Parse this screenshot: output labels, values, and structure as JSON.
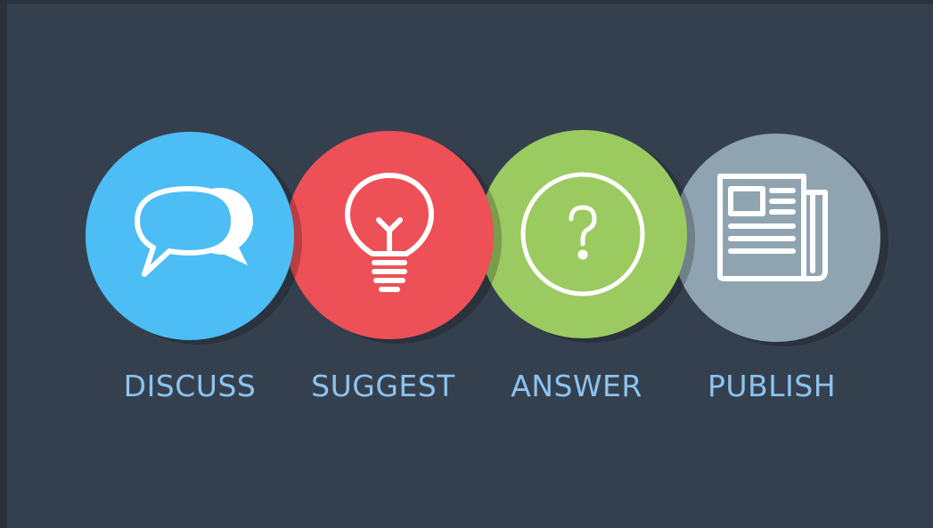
{
  "steps": [
    {
      "id": "discuss",
      "label": "DISCUSS",
      "color": "#4cbdf5",
      "icon": "chat-bubbles-icon"
    },
    {
      "id": "suggest",
      "label": "SUGGEST",
      "color": "#ed5056",
      "icon": "lightbulb-icon"
    },
    {
      "id": "answer",
      "label": "ANSWER",
      "color": "#9bca61",
      "icon": "question-mark-icon"
    },
    {
      "id": "publish",
      "label": "PUBLISH",
      "color": "#8fa4b0",
      "icon": "newspaper-icon"
    }
  ],
  "colors": {
    "background": "#35404f",
    "label_text": "#8cc3ef",
    "icon_stroke": "#ffffff"
  }
}
